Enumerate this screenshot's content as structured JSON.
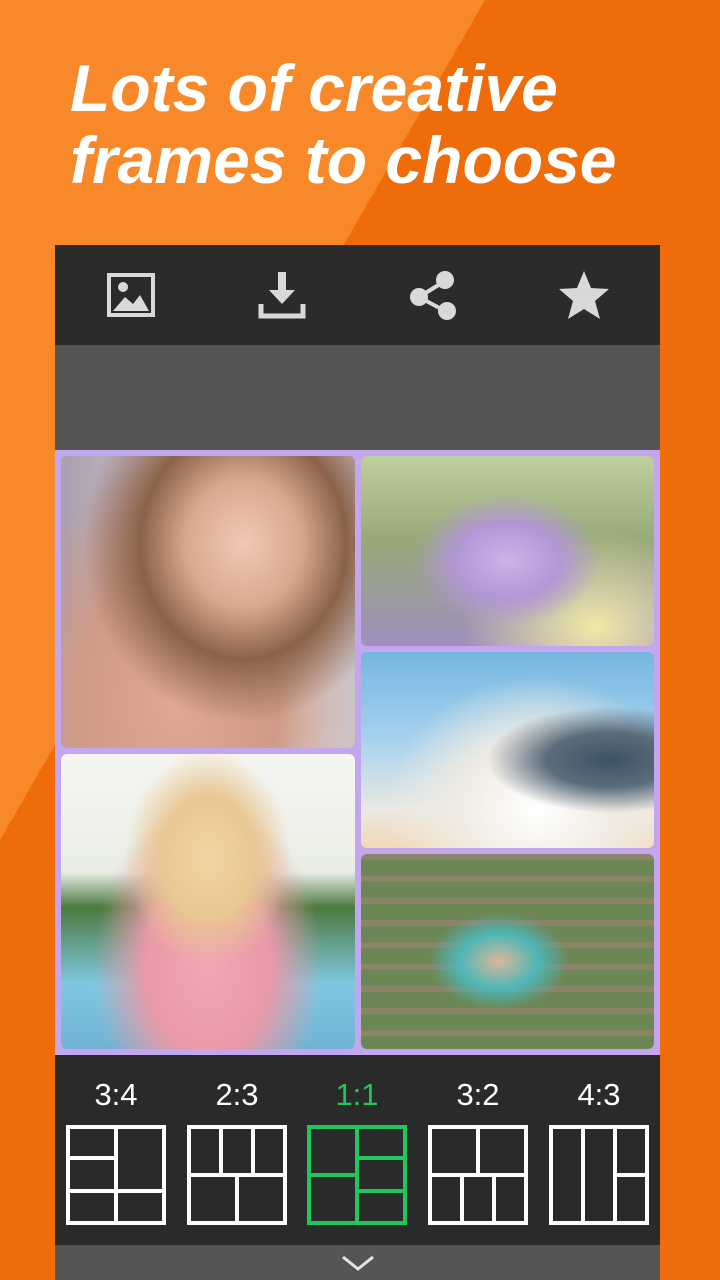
{
  "headline": {
    "line1": "Lots of creative",
    "line2": "frames to choose"
  },
  "toolbar": {
    "items": [
      {
        "icon": "image-icon"
      },
      {
        "icon": "download-icon"
      },
      {
        "icon": "share-icon"
      },
      {
        "icon": "star-icon"
      }
    ]
  },
  "ratios": [
    {
      "label": "3:4",
      "selected": false
    },
    {
      "label": "2:3",
      "selected": false
    },
    {
      "label": "1:1",
      "selected": true
    },
    {
      "label": "3:2",
      "selected": false
    },
    {
      "label": "4:3",
      "selected": false
    }
  ],
  "colors": {
    "background": "#ef6c0a",
    "background_light": "#f8892a",
    "accent_selected": "#22c55e",
    "collage_border": "#c2a6ee"
  },
  "bottom": {
    "icon": "chevron-down-icon"
  }
}
